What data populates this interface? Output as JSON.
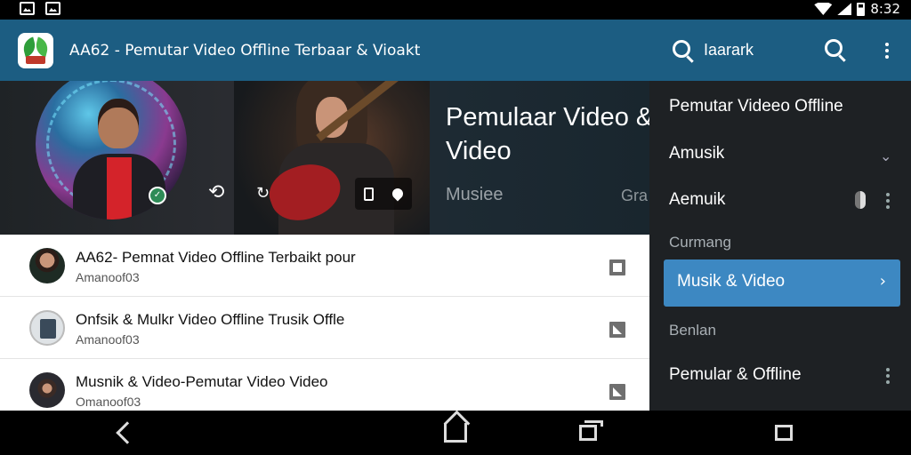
{
  "status_bar": {
    "time": "8:32"
  },
  "app_bar": {
    "title": "AA62 - Pemutar Video Offline Terbaar & Vioakt"
  },
  "hero": {
    "title": "Pemulaar Video & Video",
    "tab_music": "Musiee",
    "tab_other": "Gra"
  },
  "list": {
    "items": [
      {
        "title": "AA62- Pemnat Video Offline Terbaikt pour",
        "subtitle": "Amanoof03",
        "action_icon": "square-icon"
      },
      {
        "title": "Onfsik & Mulkr Video Offline Trusik Offle",
        "subtitle": "Amanoof03",
        "action_icon": "image-icon"
      },
      {
        "title": "Musnik & Video-Pemutar Video Video",
        "subtitle": "Omanoof03",
        "action_icon": "image-icon"
      }
    ]
  },
  "drawer": {
    "search_text": "Iaarark",
    "items": [
      {
        "label": "Pemutar Videeo Offline"
      },
      {
        "label": "Amusik"
      },
      {
        "label": "Aemuik"
      }
    ],
    "section_1": "Curmang",
    "active_item": "Musik & Video",
    "section_2": "Benlan",
    "last_item": "Pemular & Offline"
  },
  "colors": {
    "app_bar": "#1c5d82",
    "drawer_bg": "#1e2124",
    "active_item": "#3d88c2"
  }
}
